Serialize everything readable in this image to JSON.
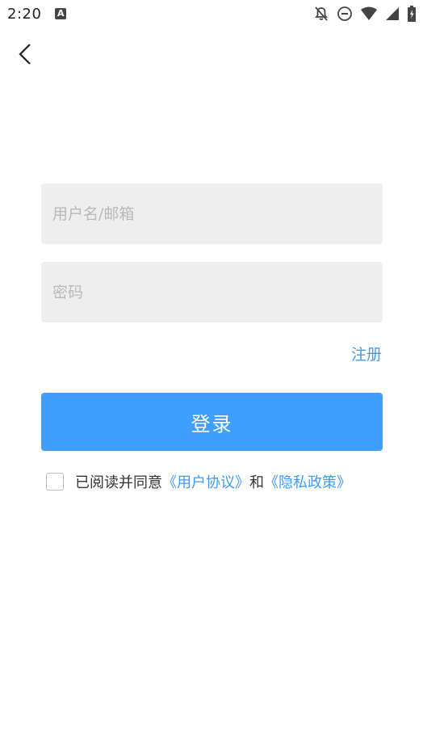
{
  "status_bar": {
    "time": "2:20",
    "app_icon_letter": "A",
    "icons": [
      "notifications-off-icon",
      "do-not-disturb-icon",
      "wifi-icon",
      "cellular-signal-icon",
      "battery-icon"
    ]
  },
  "nav": {
    "back_icon": "back-arrow-icon"
  },
  "login_form": {
    "username_placeholder": "用户名/邮箱",
    "username_value": "",
    "password_placeholder": "密码",
    "password_value": "",
    "register_label": "注册",
    "login_label": "登录"
  },
  "agreement": {
    "checked": false,
    "prefix": "已阅读并同意",
    "user_agreement": "《用户协议》",
    "conjunction": "和",
    "privacy_policy": "《隐私政策》"
  },
  "colors": {
    "accent": "#3f9ffe",
    "link": "#3d9bf5",
    "input_bg": "#eeeeee",
    "placeholder": "#b9b9b9"
  }
}
